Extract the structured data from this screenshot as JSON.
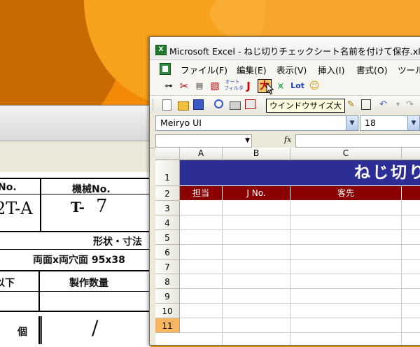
{
  "window": {
    "title": "Microsoft Excel - ねじ切りチェックシート名前を付けて保存.xls"
  },
  "menu": [
    "ファイル(F)",
    "編集(E)",
    "表示(V)",
    "挿入(I)",
    "書式(O)",
    "ツール"
  ],
  "custom_toolbar": {
    "autofilter_top": "オート",
    "autofilter_bottom": "フィルタ",
    "j_label": "J",
    "lot_label": "Lot",
    "tooltip": "ウインドウサイズ大"
  },
  "formatting": {
    "font_name": "Meiryo UI",
    "font_size": "18"
  },
  "formula_bar": {
    "fx": "fx"
  },
  "sheet": {
    "columns": [
      "A",
      "B",
      "C"
    ],
    "rows": [
      "1",
      "2",
      "3",
      "4",
      "5",
      "6",
      "7",
      "8",
      "9",
      "10",
      "11"
    ],
    "selected_row": "11",
    "banner_text": "ねじ切り",
    "header_cells": [
      "担当",
      "J No.",
      "客先"
    ]
  },
  "paper_form": {
    "no_label": "No.",
    "machine_no_label": "機械No.",
    "handwritten_left": "2T-A",
    "handwritten_prefix": "T-",
    "handwritten_number": "7",
    "shape_label": "形状・寸法",
    "shape_value": "両面x両穴面 95x38",
    "below_label": "以下",
    "qty_label": "製作数量",
    "unit_label": "個",
    "handwritten_slash": "/"
  }
}
